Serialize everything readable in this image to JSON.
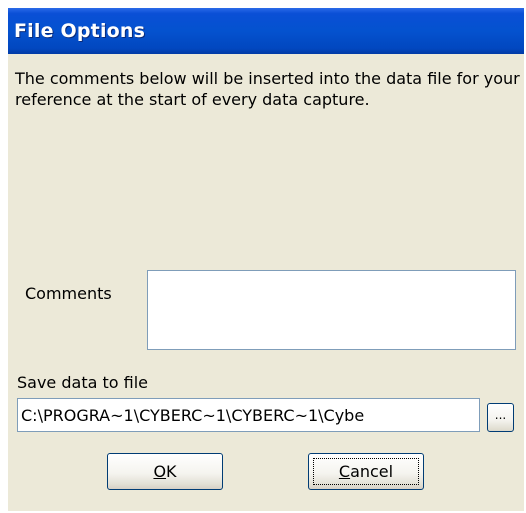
{
  "window": {
    "title": "File Options"
  },
  "description": "The comments below will be inserted into the data file for your reference at the start of every data capture.",
  "comments": {
    "label": "Comments",
    "value": ""
  },
  "save_file": {
    "label": "Save data to file",
    "path": "C:\\PROGRA~1\\CYBERC~1\\CYBERC~1\\Cybe",
    "browse_label": "..."
  },
  "buttons": {
    "ok": {
      "accel": "O",
      "rest": "K"
    },
    "cancel": {
      "accel": "C",
      "rest": "ancel"
    }
  },
  "colors": {
    "title_bar": "#0452CF",
    "dialog_face": "#ECE9D8",
    "field_border": "#7F9DB9",
    "button_border": "#003C74"
  }
}
